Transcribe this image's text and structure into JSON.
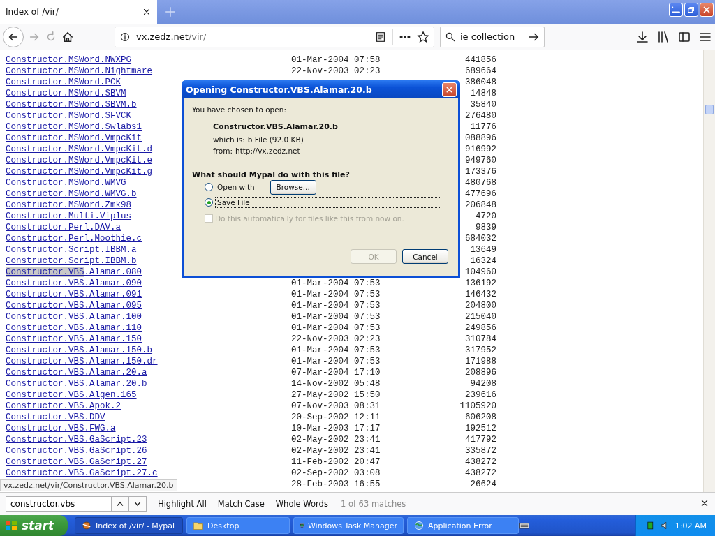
{
  "browser": {
    "tab_title": "Index of /vir/",
    "url_host": "vx.zedz.net",
    "url_path": "/vir/",
    "search_value": "ie collection"
  },
  "listing": {
    "rows": [
      {
        "name": "Constructor.MSWord.NWXPG",
        "date": "01-Mar-2004 07:58",
        "size": "441856"
      },
      {
        "name": "Constructor.MSWord.Nightmare",
        "date": "22-Nov-2003 02:23",
        "size": "689664"
      },
      {
        "name": "Constructor.MSWord.PCK",
        "size": "386048"
      },
      {
        "name": "Constructor.MSWord.SBVM",
        "size": "14848"
      },
      {
        "name": "Constructor.MSWord.SBVM.b",
        "size": "35840"
      },
      {
        "name": "Constructor.MSWord.SFVCK",
        "size": "276480"
      },
      {
        "name": "Constructor.MSWord.Swlabs1",
        "size": "11776"
      },
      {
        "name": "Constructor.MSWord.VmpcKit",
        "size": "088896"
      },
      {
        "name": "Constructor.MSWord.VmpcKit.d",
        "size": "916992"
      },
      {
        "name": "Constructor.MSWord.VmpcKit.e",
        "size": "949760"
      },
      {
        "name": "Constructor.MSWord.VmpcKit.g",
        "size": "173376"
      },
      {
        "name": "Constructor.MSWord.WMVG",
        "size": "480768"
      },
      {
        "name": "Constructor.MSWord.WMVG.b",
        "size": "477696"
      },
      {
        "name": "Constructor.MSWord.Zmk98",
        "size": "206848"
      },
      {
        "name": "Constructor.Multi.Viplus",
        "size": "4720"
      },
      {
        "name": "Constructor.Perl.DAV.a",
        "size": "9839"
      },
      {
        "name": "Constructor.Perl.Moothie.c",
        "size": "684032"
      },
      {
        "name": "Constructor.Script.IBBM.a",
        "size": "13649"
      },
      {
        "name": "Constructor.Script.IBBM.b",
        "size": "16324"
      },
      {
        "match": "Constructor.VBS",
        "name": ".Alamar.080",
        "size": "104960"
      },
      {
        "name": "Constructor.VBS.Alamar.090",
        "date": "01-Mar-2004 07:53",
        "size": "136192"
      },
      {
        "name": "Constructor.VBS.Alamar.091",
        "date": "01-Mar-2004 07:53",
        "size": "146432"
      },
      {
        "name": "Constructor.VBS.Alamar.095",
        "date": "01-Mar-2004 07:53",
        "size": "204800"
      },
      {
        "name": "Constructor.VBS.Alamar.100",
        "date": "01-Mar-2004 07:53",
        "size": "215040"
      },
      {
        "name": "Constructor.VBS.Alamar.110",
        "date": "01-Mar-2004 07:53",
        "size": "249856"
      },
      {
        "name": "Constructor.VBS.Alamar.150",
        "date": "22-Nov-2003 02:23",
        "size": "310784"
      },
      {
        "name": "Constructor.VBS.Alamar.150.b",
        "date": "01-Mar-2004 07:53",
        "size": "317952"
      },
      {
        "name": "Constructor.VBS.Alamar.150.dr",
        "date": "01-Mar-2004 07:53",
        "size": "171988"
      },
      {
        "name": "Constructor.VBS.Alamar.20.a",
        "date": "07-Mar-2004 17:10",
        "size": "208896"
      },
      {
        "name": "Constructor.VBS.Alamar.20.b",
        "date": "14-Nov-2002 05:48",
        "size": "94208"
      },
      {
        "name": "Constructor.VBS.Algen.165",
        "date": "27-May-2002 15:50",
        "size": "239616"
      },
      {
        "name": "Constructor.VBS.Apok.2",
        "date": "07-Nov-2003 08:31",
        "size": "1105920"
      },
      {
        "name": "Constructor.VBS.DDV",
        "date": "20-Sep-2002 12:11",
        "size": "606208"
      },
      {
        "name": "Constructor.VBS.FWG.a",
        "date": "10-Mar-2003 17:17",
        "size": "192512"
      },
      {
        "name": "Constructor.VBS.GaScript.23",
        "date": "02-May-2002 23:41",
        "size": "417792"
      },
      {
        "name": "Constructor.VBS.GaScript.26",
        "date": "02-May-2002 23:41",
        "size": "335872"
      },
      {
        "name": "Constructor.VBS.GaScript.27",
        "date": "11-Feb-2002 20:47",
        "size": "438272"
      },
      {
        "name": "Constructor.VBS.GaScript.27.c",
        "date": "02-Sep-2002 03:08",
        "size": "438272"
      },
      {
        "date": "28-Feb-2003 16:55",
        "size": "26624"
      }
    ]
  },
  "status_link": "vx.zedz.net/vir/Constructor.VBS.Alamar.20.b",
  "dialog": {
    "title": "Opening Constructor.VBS.Alamar.20.b",
    "intro": "You have chosen to open:",
    "file_name": "Constructor.VBS.Alamar.20.b",
    "type_label": "which is:",
    "type_value": "b File (92.0 KB)",
    "from_label": "from:",
    "from_value": "http://vx.zedz.net",
    "question": "What should Mypal do with this file?",
    "options": [
      {
        "label": "Open with",
        "selected": false,
        "button": "Browse..."
      },
      {
        "label": "Save File",
        "selected": true
      }
    ],
    "auto_checkbox": {
      "label": "Do this automatically for files like this from now on.",
      "checked": false,
      "disabled": true
    },
    "buttons": [
      {
        "label": "OK",
        "disabled": true
      },
      {
        "label": "Cancel",
        "disabled": false
      }
    ]
  },
  "find_bar": {
    "value": "constructor.vbs",
    "options": [
      "Highlight All",
      "Match Case",
      "Whole Words"
    ],
    "result": "1 of 63 matches"
  },
  "taskbar": {
    "start": "start",
    "items": [
      {
        "label": "Index of /vir/ - Mypal",
        "kind": "browser",
        "selected": true
      },
      {
        "label": "Desktop",
        "kind": "folder",
        "selected": false
      },
      {
        "label": "Windows Task Manager",
        "kind": "monitor",
        "selected": false
      },
      {
        "label": "Application Error",
        "kind": "globe",
        "selected": false
      }
    ],
    "clock": "1:02 AM"
  }
}
